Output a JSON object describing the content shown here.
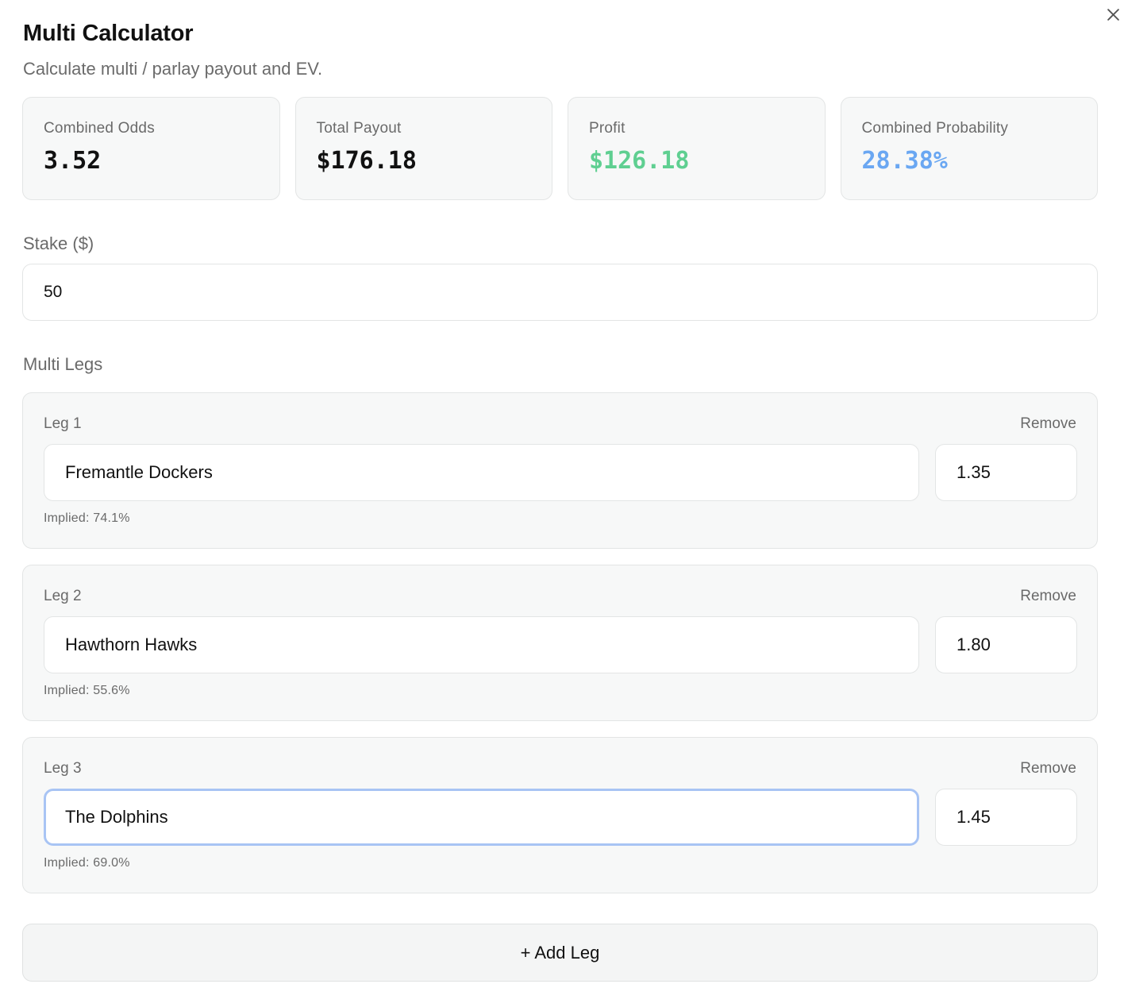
{
  "header": {
    "title": "Multi Calculator",
    "subtitle": "Calculate multi / parlay payout and EV."
  },
  "stats": [
    {
      "label": "Combined Odds",
      "value": "3.52",
      "color": "#111111"
    },
    {
      "label": "Total Payout",
      "value": "$176.18",
      "color": "#111111"
    },
    {
      "label": "Profit",
      "value": "$126.18",
      "color": "#5fcf91"
    },
    {
      "label": "Combined Probability",
      "value": "28.38%",
      "color": "#6aa7f2"
    }
  ],
  "stake": {
    "label": "Stake ($)",
    "value": "50"
  },
  "legs_heading": "Multi Legs",
  "legs": [
    {
      "title": "Leg 1",
      "remove_label": "Remove",
      "name": "Fremantle Dockers",
      "odds": "1.35",
      "implied": "Implied: 74.1%"
    },
    {
      "title": "Leg 2",
      "remove_label": "Remove",
      "name": "Hawthorn Hawks",
      "odds": "1.80",
      "implied": "Implied: 55.6%"
    },
    {
      "title": "Leg 3",
      "remove_label": "Remove",
      "name": "The Dolphins",
      "odds": "1.45",
      "implied": "Implied: 69.0%",
      "focused": true
    }
  ],
  "add_leg_label": "+ Add Leg",
  "icons": {
    "close": "close-icon"
  },
  "colors": {
    "accent_focus": "#a8c4f4",
    "profit": "#5fcf91",
    "probability": "#6aa7f2"
  }
}
